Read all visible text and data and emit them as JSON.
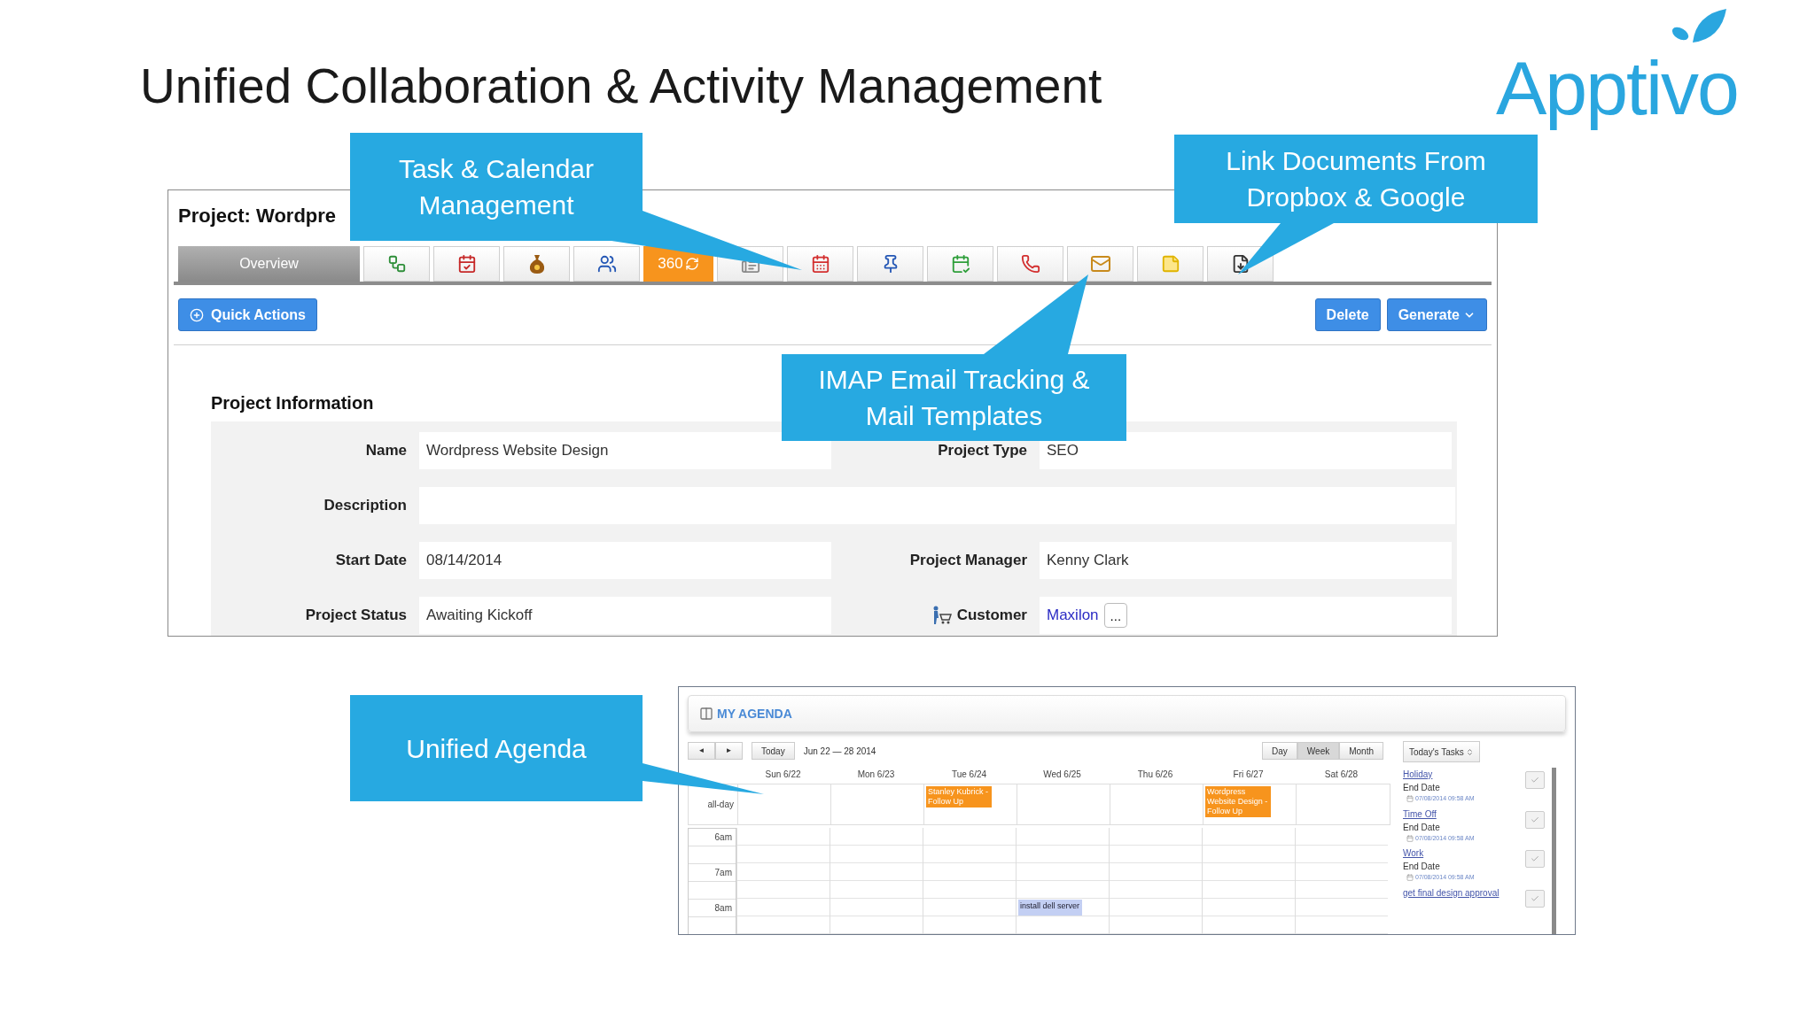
{
  "slide": {
    "title": "Unified Collaboration & Activity Management",
    "logo": "Apptivo"
  },
  "callouts": [
    {
      "text": "Task & Calendar\nManagement"
    },
    {
      "text": "Link Documents From\nDropbox & Google"
    },
    {
      "text": "IMAP Email Tracking &\nMail Templates"
    },
    {
      "text": "Unified Agenda"
    }
  ],
  "project": {
    "title": "Project: Wordpre",
    "tabs": [
      {
        "kind": "text",
        "label": "Overview",
        "selected": true
      },
      {
        "kind": "icon",
        "selected": false
      },
      {
        "kind": "icon",
        "selected": false
      },
      {
        "kind": "icon",
        "selected": false
      },
      {
        "kind": "icon",
        "selected": false
      },
      {
        "kind": "accent",
        "label": "360",
        "selected": false
      },
      {
        "kind": "icon",
        "selected": false
      },
      {
        "kind": "icon",
        "selected": false
      },
      {
        "kind": "icon",
        "selected": false
      },
      {
        "kind": "icon",
        "selected": false
      },
      {
        "kind": "icon",
        "selected": false
      },
      {
        "kind": "icon",
        "selected": false
      },
      {
        "kind": "icon",
        "selected": false
      },
      {
        "kind": "icon",
        "selected": false
      }
    ],
    "quick_actions": "Quick Actions",
    "buttons": [
      {
        "label": "Delete",
        "kind": "plain"
      },
      {
        "label": "Generate",
        "kind": "menu"
      }
    ],
    "section": "Project Information",
    "rows": [
      {
        "kind": "pair",
        "fields": [
          {
            "label": "Name",
            "value": "Wordpress Website Design"
          },
          {
            "label": "Project Type",
            "value": "SEO"
          }
        ]
      },
      {
        "kind": "wide",
        "fields": [
          {
            "label": "Description"
          }
        ]
      },
      {
        "kind": "pair",
        "fields": [
          {
            "label": "Start Date",
            "value": "08/14/2014"
          },
          {
            "label": "Project Manager",
            "value": "Kenny Clark"
          }
        ]
      },
      {
        "kind": "pair",
        "fields": [
          {
            "label": "Project Status",
            "value": "Awaiting Kickoff"
          },
          {
            "label": "Customer",
            "value": "Maxilon",
            "kind": "link",
            "more": "..."
          }
        ]
      }
    ]
  },
  "agenda": {
    "title": "MY AGENDA",
    "nav": [
      "◄",
      "►"
    ],
    "today": "Today",
    "range": "Jun 22 — 28 2014",
    "views": [
      {
        "label": "Day",
        "selected": false
      },
      {
        "label": "Week",
        "selected": true
      },
      {
        "label": "Month",
        "selected": false
      }
    ],
    "all_day": "all-day",
    "hours": [
      "6am",
      "7am",
      "8am"
    ],
    "days": [
      {
        "label": "Sun 6/22"
      },
      {
        "label": "Mon 6/23"
      },
      {
        "label": "Tue 6/24",
        "events": [
          {
            "text": "Stanley Kubrick - Follow Up",
            "kind": "all_day",
            "color": "#f7941d"
          }
        ]
      },
      {
        "label": "Wed 6/25",
        "events": [
          {
            "text": "install dell server",
            "kind": "timed",
            "color": "#c3cff3"
          }
        ]
      },
      {
        "label": "Thu 6/26"
      },
      {
        "label": "Fri 6/27",
        "events": [
          {
            "text": "Wordpress Website Design - Follow Up",
            "kind": "all_day",
            "color": "#f7941d"
          }
        ]
      },
      {
        "label": "Sat 6/28"
      }
    ],
    "tasks_filter": "Today's Tasks",
    "tasks": [
      {
        "name": "Holiday",
        "due_label": "End Date",
        "due": "07/08/2014 09:58 AM"
      },
      {
        "name": "Time Off",
        "due_label": "End Date",
        "due": "07/08/2014 09:58 AM"
      },
      {
        "name": "Work",
        "due_label": "End Date",
        "due": "07/08/2014 09:58 AM"
      },
      {
        "name": "get final design approval"
      }
    ]
  }
}
